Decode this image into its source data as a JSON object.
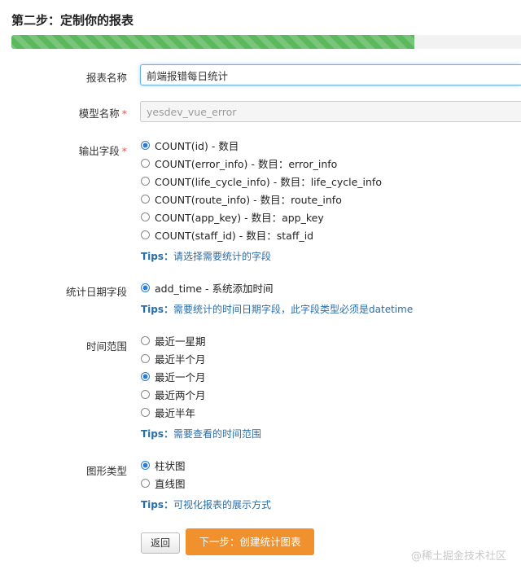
{
  "header": {
    "title": "第二步：定制你的报表",
    "progress": 0.79
  },
  "form": {
    "report_name": {
      "label": "报表名称",
      "value": "前端报错每日统计"
    },
    "model_name": {
      "label": "模型名称",
      "required_mark": "*",
      "placeholder": "yesdev_vue_error"
    },
    "output_fields": {
      "label": "输出字段",
      "required_mark": "*",
      "options": [
        "COUNT(id) - 数目",
        "COUNT(error_info) - 数目：error_info",
        "COUNT(life_cycle_info) - 数目：life_cycle_info",
        "COUNT(route_info) - 数目：route_info",
        "COUNT(app_key) - 数目：app_key",
        "COUNT(staff_id) - 数目：staff_id"
      ],
      "selected": 0,
      "tips_label": "Tips：",
      "tips": "请选择需要统计的字段"
    },
    "date_field": {
      "label": "统计日期字段",
      "options": [
        "add_time - 系统添加时间"
      ],
      "selected": 0,
      "tips_label": "Tips：",
      "tips": "需要统计的时间日期字段，此字段类型必须是datetime"
    },
    "time_range": {
      "label": "时间范围",
      "options": [
        "最近一星期",
        "最近半个月",
        "最近一个月",
        "最近两个月",
        "最近半年"
      ],
      "selected": 2,
      "tips_label": "Tips：",
      "tips": "需要查看的时间范围"
    },
    "chart_type": {
      "label": "图形类型",
      "options": [
        "柱状图",
        "直线图"
      ],
      "selected": 0,
      "tips_label": "Tips：",
      "tips": "可视化报表的展示方式"
    }
  },
  "buttons": {
    "back": "返回",
    "next": "下一步：创建统计图表"
  },
  "watermark": "@稀土掘金技术社区",
  "colors": {
    "progress": "#5cb85c",
    "accent": "#f0912e",
    "radio": "#2a7fd4",
    "tips": "#2a6ea8"
  }
}
